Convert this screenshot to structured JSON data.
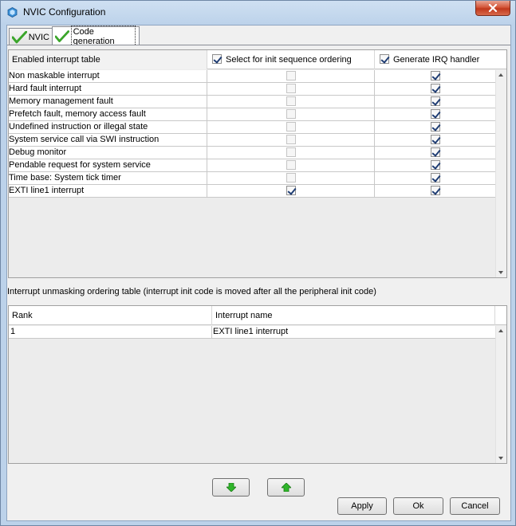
{
  "window": {
    "title": "NVIC Configuration"
  },
  "tabs": [
    {
      "label": "NVIC",
      "active": false
    },
    {
      "label": "Code generation",
      "active": true
    }
  ],
  "interrupt_table": {
    "headers": {
      "name": "Enabled interrupt table",
      "init_order": "Select for init sequence ordering",
      "irq_handler": "Generate IRQ handler"
    },
    "header_checks": {
      "init_order": true,
      "irq_handler": true
    },
    "rows": [
      {
        "name": "Non maskable interrupt",
        "init_order": false,
        "init_enabled": false,
        "irq_handler": true
      },
      {
        "name": "Hard fault interrupt",
        "init_order": false,
        "init_enabled": false,
        "irq_handler": true
      },
      {
        "name": "Memory management fault",
        "init_order": false,
        "init_enabled": false,
        "irq_handler": true
      },
      {
        "name": "Prefetch fault, memory access fault",
        "init_order": false,
        "init_enabled": false,
        "irq_handler": true
      },
      {
        "name": "Undefined instruction or illegal state",
        "init_order": false,
        "init_enabled": false,
        "irq_handler": true
      },
      {
        "name": "System service call via SWI instruction",
        "init_order": false,
        "init_enabled": false,
        "irq_handler": true
      },
      {
        "name": "Debug monitor",
        "init_order": false,
        "init_enabled": false,
        "irq_handler": true
      },
      {
        "name": "Pendable request for system service",
        "init_order": false,
        "init_enabled": false,
        "irq_handler": true
      },
      {
        "name": "Time base: System tick timer",
        "init_order": false,
        "init_enabled": false,
        "irq_handler": true
      },
      {
        "name": "EXTI line1 interrupt",
        "init_order": true,
        "init_enabled": true,
        "irq_handler": true
      }
    ]
  },
  "ordering": {
    "caption": "Interrupt unmasking ordering table (interrupt init code is moved after all the peripheral init code)",
    "headers": {
      "rank": "Rank",
      "name": "Interrupt name"
    },
    "rows": [
      {
        "rank": "1",
        "name": "EXTI line1 interrupt"
      }
    ]
  },
  "buttons": {
    "apply": "Apply",
    "ok": "Ok",
    "cancel": "Cancel",
    "move_down_icon": "arrow-down-icon",
    "move_up_icon": "arrow-up-icon"
  },
  "colors": {
    "check_green": "#3aa52a",
    "arrow_green": "#2fb52a"
  }
}
